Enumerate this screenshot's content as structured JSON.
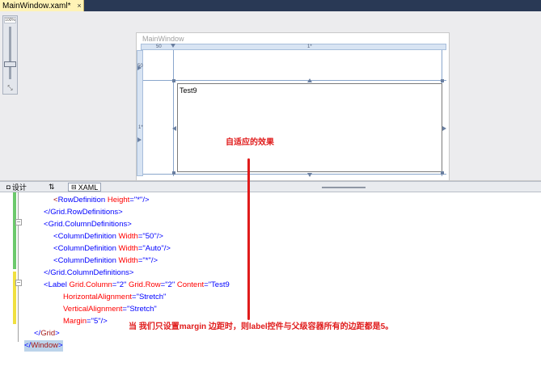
{
  "tab": {
    "title": "MainWindow.xaml*",
    "close_glyph": "×"
  },
  "zoom": {
    "percent": "100%",
    "fit_glyph": "⤡"
  },
  "designer": {
    "window_title": "MainWindow",
    "ruler_col0": "50",
    "ruler_col2": "1*",
    "ruler_row0": "50",
    "ruler_row2": "1*",
    "label_content": "Test9",
    "annotation": "自适应的效果"
  },
  "split": {
    "design_label": "设计",
    "swap_label": "⇅",
    "xaml_label": "XAML"
  },
  "code": {
    "lines": [
      {
        "indent": 3,
        "parts": [
          [
            "tag",
            "<"
          ],
          [
            "pn",
            "RowDefinition"
          ],
          [
            "attr",
            " Height"
          ],
          [
            "pn",
            "="
          ],
          [
            "val",
            "\"*\""
          ],
          [
            "pn",
            "/>"
          ]
        ]
      },
      {
        "indent": 2,
        "parts": [
          [
            "pn",
            "</"
          ],
          [
            "pn",
            "Grid.RowDefinitions"
          ],
          [
            "pn",
            ">"
          ]
        ]
      },
      {
        "indent": 2,
        "parts": [
          [
            "pn",
            "<"
          ],
          [
            "pn",
            "Grid.ColumnDefinitions"
          ],
          [
            "pn",
            ">"
          ]
        ]
      },
      {
        "indent": 3,
        "parts": [
          [
            "pn",
            "<"
          ],
          [
            "pn",
            "ColumnDefinition"
          ],
          [
            "attr",
            " Width"
          ],
          [
            "pn",
            "="
          ],
          [
            "val",
            "\"50\""
          ],
          [
            "pn",
            "/>"
          ]
        ]
      },
      {
        "indent": 3,
        "parts": [
          [
            "pn",
            "<"
          ],
          [
            "pn",
            "ColumnDefinition"
          ],
          [
            "attr",
            " Width"
          ],
          [
            "pn",
            "="
          ],
          [
            "val",
            "\"Auto\""
          ],
          [
            "pn",
            "/>"
          ]
        ]
      },
      {
        "indent": 3,
        "parts": [
          [
            "pn",
            "<"
          ],
          [
            "pn",
            "ColumnDefinition"
          ],
          [
            "attr",
            " Width"
          ],
          [
            "pn",
            "="
          ],
          [
            "val",
            "\"*\""
          ],
          [
            "pn",
            "/>"
          ]
        ]
      },
      {
        "indent": 2,
        "parts": [
          [
            "pn",
            "</"
          ],
          [
            "pn",
            "Grid.ColumnDefinitions"
          ],
          [
            "pn",
            ">"
          ]
        ]
      },
      {
        "indent": 2,
        "parts": [
          [
            "pn",
            "<"
          ],
          [
            "pn",
            "Label"
          ],
          [
            "attr",
            " Grid.Column"
          ],
          [
            "pn",
            "="
          ],
          [
            "val",
            "\"2\""
          ],
          [
            "attr",
            " Grid.Row"
          ],
          [
            "pn",
            "="
          ],
          [
            "val",
            "\"2\""
          ],
          [
            "attr",
            " Content"
          ],
          [
            "pn",
            "="
          ],
          [
            "val",
            "\"Test9"
          ]
        ]
      },
      {
        "indent": 4,
        "parts": [
          [
            "attr",
            "HorizontalAlignment"
          ],
          [
            "pn",
            "="
          ],
          [
            "val",
            "\"Stretch\""
          ]
        ]
      },
      {
        "indent": 4,
        "parts": [
          [
            "attr",
            "VerticalAlignment"
          ],
          [
            "pn",
            "="
          ],
          [
            "val",
            "\"Stretch\""
          ]
        ]
      },
      {
        "indent": 4,
        "parts": [
          [
            "attr",
            "Margin"
          ],
          [
            "pn",
            "="
          ],
          [
            "val",
            "\"5\""
          ],
          [
            "pn",
            "/>"
          ]
        ]
      },
      {
        "indent": 1,
        "parts": [
          [
            "pn",
            "</"
          ],
          [
            "tag",
            "Grid"
          ],
          [
            "pn",
            ">"
          ]
        ]
      },
      {
        "indent": 0,
        "parts": [
          [
            "pn",
            "</"
          ],
          [
            "tag",
            "Window"
          ],
          [
            "pn",
            ">"
          ]
        ]
      }
    ],
    "annotation": "当 我们只设置margin 边距时，则label控件与父级容器所有的边距都是5。"
  },
  "colors": {
    "annotation": "#e01b1b",
    "tab_active": "#fff3b6",
    "chrome": "#293955"
  }
}
